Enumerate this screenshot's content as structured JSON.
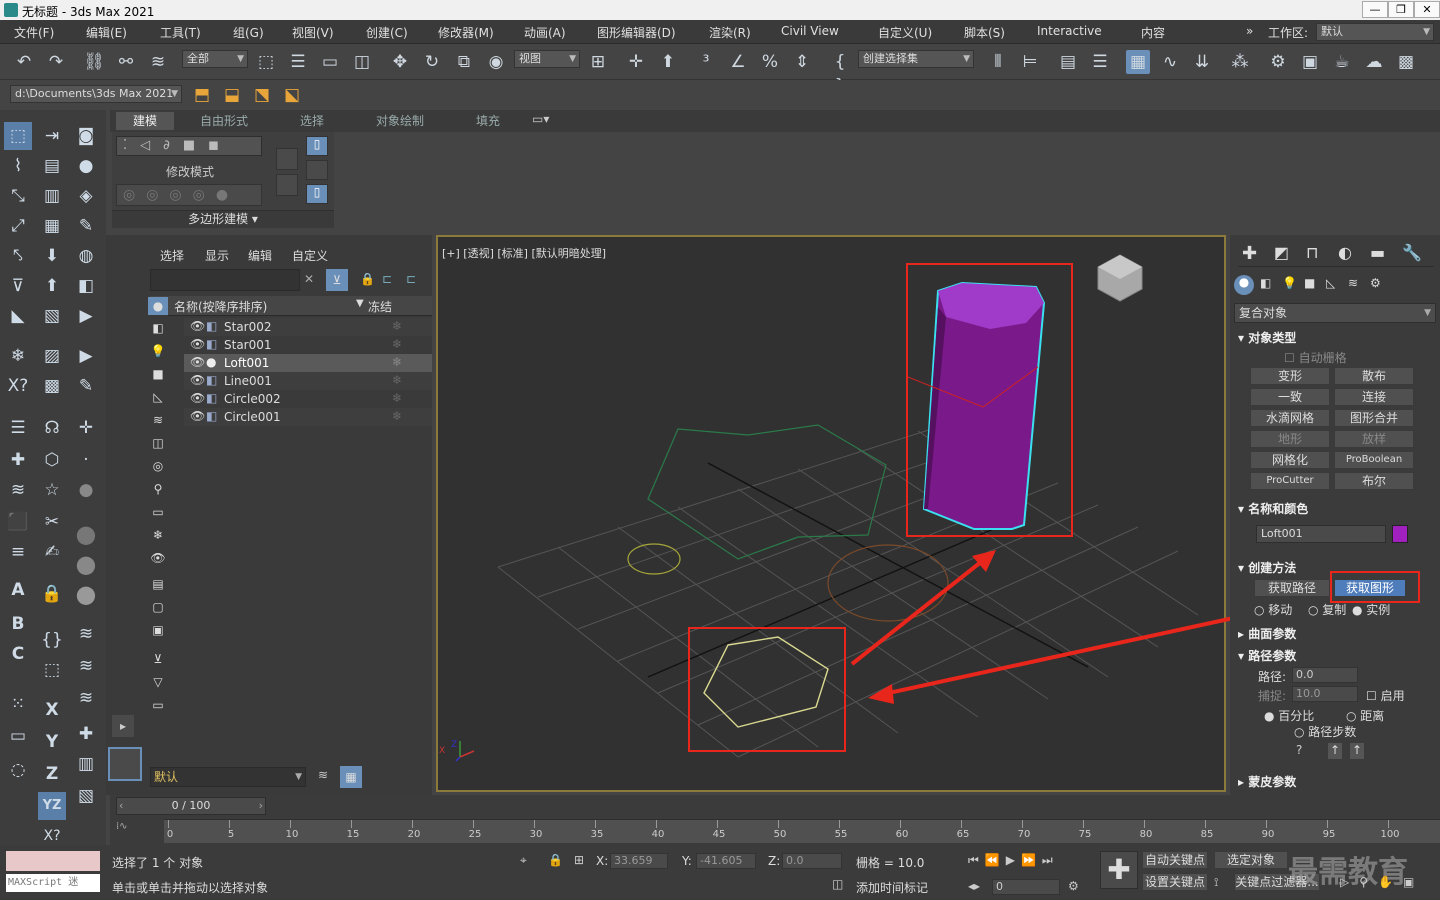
{
  "window": {
    "title": "无标题 - 3ds Max 2021",
    "min": "—",
    "max": "❐",
    "close": "✕"
  },
  "menu": [
    "文件(F)",
    "编辑(E)",
    "工具(T)",
    "组(G)",
    "视图(V)",
    "创建(C)",
    "修改器(M)",
    "动画(A)",
    "图形编辑器(D)",
    "渲染(R)",
    "Civil View",
    "自定义(U)",
    "脚本(S)",
    "Interactive",
    "内容"
  ],
  "workspace": {
    "label": "工作区:",
    "value": "默认"
  },
  "toolbar": {
    "filter": "全部",
    "refcoord": "视图",
    "selset": "创建选择集"
  },
  "path": {
    "value": "d:\\Documents\\3ds Max 2021"
  },
  "ribbon": {
    "tabs": [
      "建模",
      "自由形式",
      "选择",
      "对象绘制",
      "填充"
    ],
    "modify_mode": "修改模式",
    "poly_modeling": "多边形建模"
  },
  "scene": {
    "menu": [
      "选择",
      "显示",
      "编辑",
      "自定义"
    ],
    "col_name": "名称(按降序排序)",
    "col_freeze": "冻结",
    "items": [
      "Star002",
      "Star001",
      "Loft001",
      "Line001",
      "Circle002",
      "Circle001"
    ],
    "layer": "默认"
  },
  "viewport": {
    "label": "[+] [透视] [标准] [默认明暗处理]",
    "gizmo_x": "X",
    "gizmo_z": "Z"
  },
  "cmd": {
    "category": "复合对象",
    "roll_objtype": "对象类型",
    "autogrid": "自动栅格",
    "buttons": [
      [
        "变形",
        "散布"
      ],
      [
        "一致",
        "连接"
      ],
      [
        "水滴网格",
        "图形合并"
      ],
      [
        "地形",
        "放样"
      ],
      [
        "网格化",
        "ProBoolean"
      ],
      [
        "ProCutter",
        "布尔"
      ]
    ],
    "roll_namecolor": "名称和颜色",
    "obj_name": "Loft001",
    "obj_color": "#a020c0",
    "roll_create": "创建方法",
    "get_path": "获取路径",
    "get_shape": "获取图形",
    "opt_move": "移动",
    "opt_copy": "复制",
    "opt_instance": "实例",
    "roll_surface": "曲面参数",
    "roll_path": "路径参数",
    "path_label": "路径:",
    "path_val": "0.0",
    "snap_label": "捕捉:",
    "snap_val": "10.0",
    "enable": "启用",
    "percent": "百分比",
    "distance": "距离",
    "path_steps": "路径步数",
    "roll_skin": "蒙皮参数"
  },
  "timeline": {
    "frame": "0 / 100",
    "ticks": [
      "0",
      "5",
      "10",
      "15",
      "20",
      "25",
      "30",
      "35",
      "40",
      "45",
      "50",
      "55",
      "60",
      "65",
      "70",
      "75",
      "80",
      "85",
      "90",
      "95",
      "100"
    ]
  },
  "status": {
    "maxscript": "MAXScript 迷",
    "selected": "选择了 1 个 对象",
    "hint": "单击或单击并拖动以选择对象",
    "x_label": "X:",
    "x": "33.659",
    "y_label": "Y:",
    "y": "-41.605",
    "z_label": "Z:",
    "z": "0.0",
    "grid": "栅格 = 10.0",
    "add_tag": "添加时间标记",
    "autokey": "自动关键点",
    "selobj": "选定对象",
    "setkey": "设置关键点",
    "keyfilter": "关键点过滤器...",
    "frame": "0"
  },
  "watermark": "最需教育"
}
